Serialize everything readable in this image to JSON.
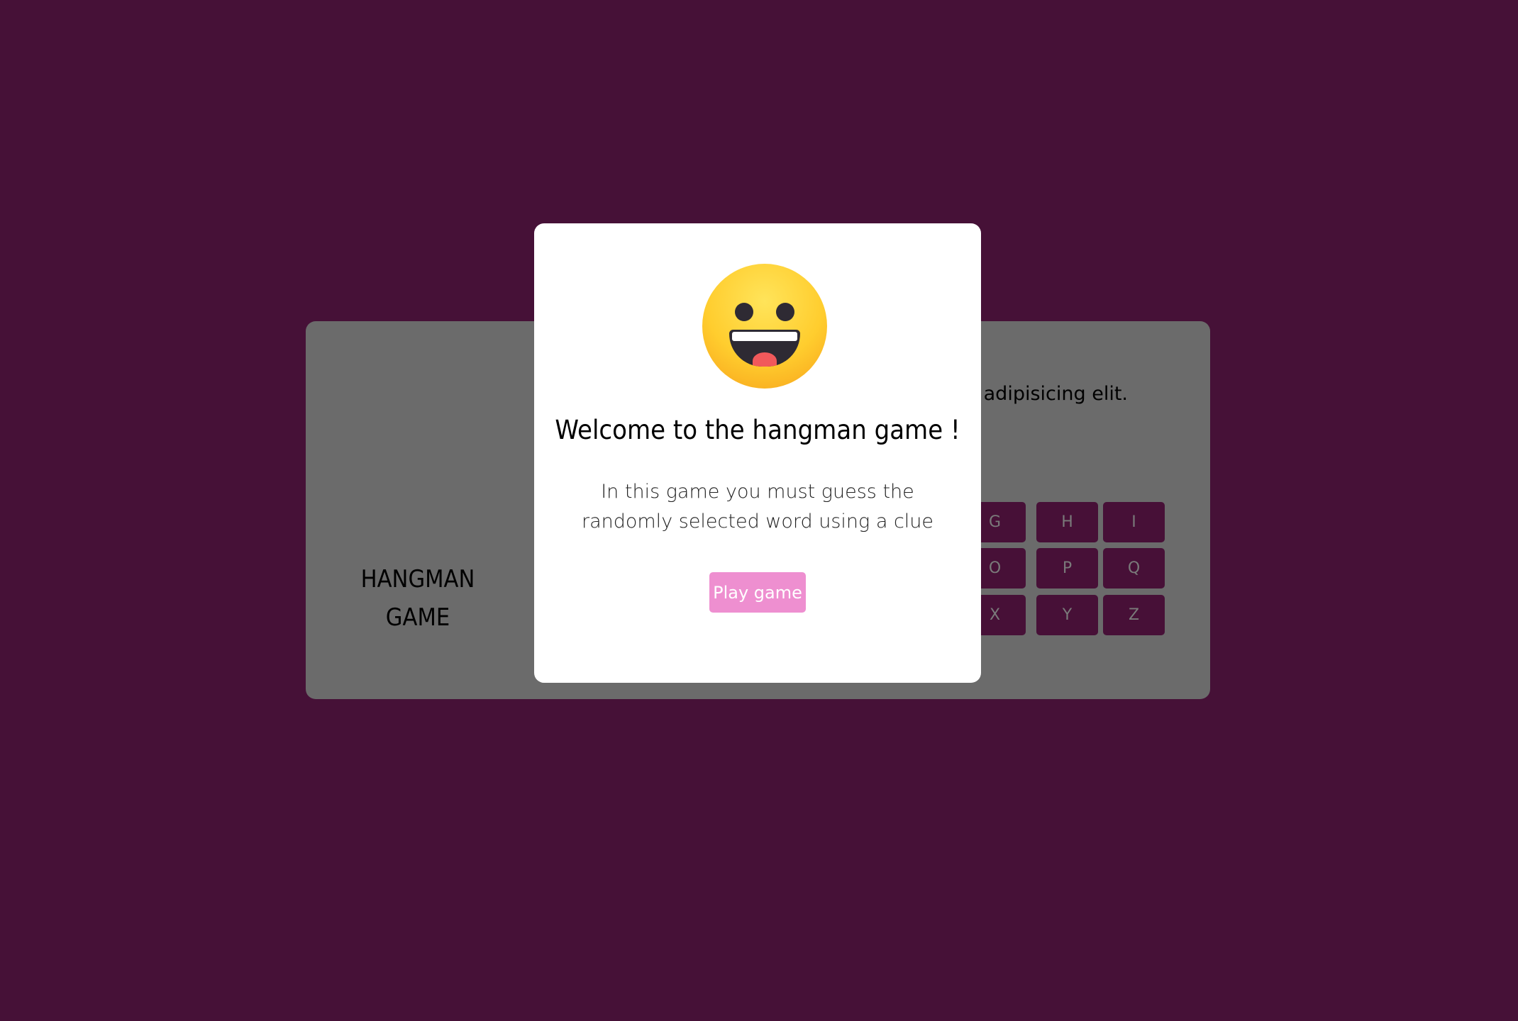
{
  "colors": {
    "page_background": "#461137",
    "panel_background_dimmed": "#6b6b6b",
    "key_background": "#471037",
    "modal_background": "#ffffff",
    "play_button": "#ee8fd0"
  },
  "game": {
    "title_line1": "HANGMAN",
    "title_line2": "GAME",
    "clue_visible_text": "ur adipisicing elit.",
    "keyboard": {
      "row1": [
        "G",
        "H",
        "I"
      ],
      "row2": [
        "O",
        "P",
        "Q"
      ],
      "row3": [
        "X",
        "Y",
        "Z"
      ]
    }
  },
  "modal": {
    "icon": "grinning-face-emoji-icon",
    "title": "Welcome to the hangman game !",
    "description": "In this game you must guess the randomly selected word using a clue",
    "play_button_label": "Play game"
  }
}
